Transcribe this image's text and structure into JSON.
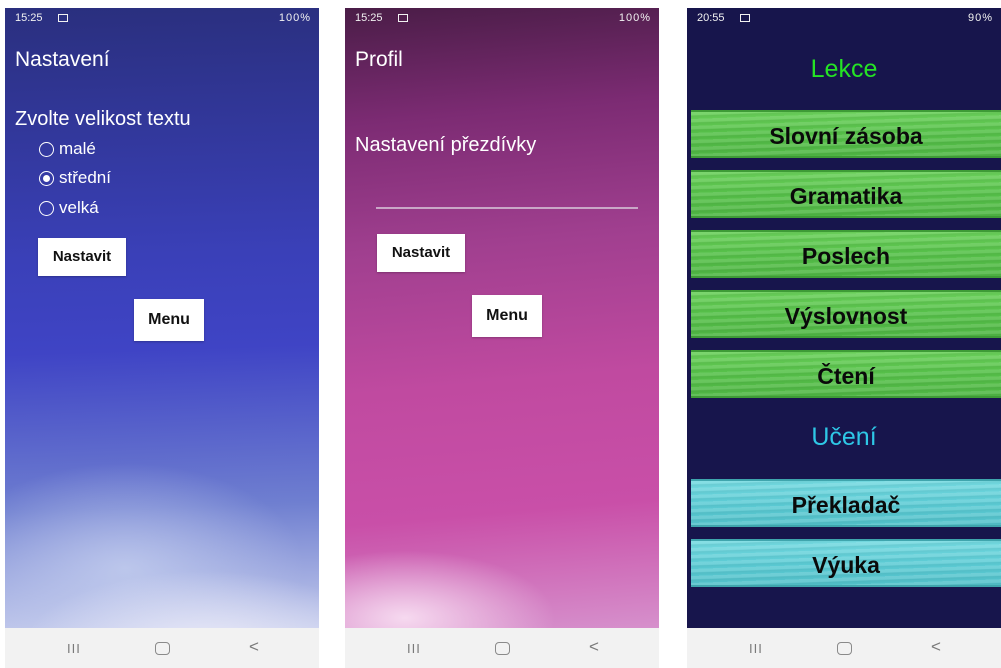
{
  "screens": [
    {
      "status": {
        "time": "15:25",
        "right": "100%"
      },
      "title": "Nastavení",
      "prompt": "Zvolte velikost textu",
      "options": [
        {
          "label": "malé",
          "selected": false
        },
        {
          "label": "střední",
          "selected": true
        },
        {
          "label": "velká",
          "selected": false
        }
      ],
      "set_label": "Nastavit",
      "menu_label": "Menu"
    },
    {
      "status": {
        "time": "15:25",
        "right": "100%"
      },
      "title": "Profil",
      "nickname_label": "Nastavení přezdívky",
      "nickname_value": "",
      "set_label": "Nastavit",
      "menu_label": "Menu"
    },
    {
      "status": {
        "time": "20:55",
        "right": "90%"
      },
      "sections": [
        {
          "title": "Lekce",
          "color": "#25e325",
          "items": [
            "Slovní zásoba",
            "Gramatika",
            "Poslech",
            "Výslovnost",
            "Čtení"
          ]
        },
        {
          "title": "Učení",
          "color": "#2ec7e6",
          "items": [
            "Překladač",
            "Výuka"
          ]
        }
      ]
    }
  ],
  "navbar": {
    "icons": [
      "recent-apps-icon",
      "home-icon",
      "back-icon"
    ],
    "recent_glyph": "III",
    "back_glyph": "<"
  }
}
